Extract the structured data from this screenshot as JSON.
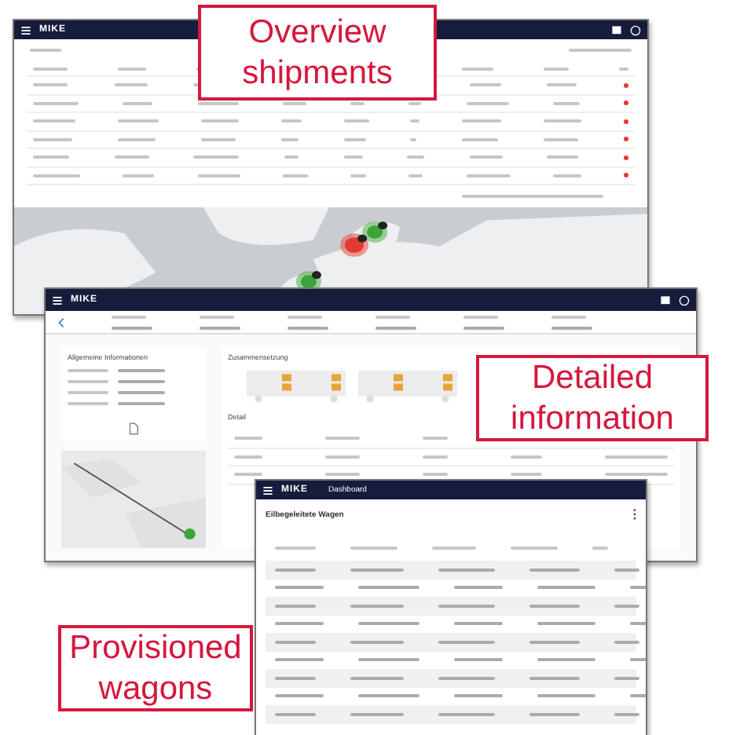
{
  "overview_window": {
    "logo": "MIKE"
  },
  "detail_window": {
    "logo": "MIKE",
    "sections": [
      "Allgemeine Informationen",
      "Zusammensetzung",
      "Detail"
    ]
  },
  "wagons_window": {
    "logo": "MIKE",
    "header": "Dashboard",
    "title": "Eilbegeleitete Wagen"
  },
  "callouts": [
    {
      "text": "Overview shipments"
    },
    {
      "text": "Detailed information"
    },
    {
      "text": "Provisioned wagons"
    }
  ]
}
